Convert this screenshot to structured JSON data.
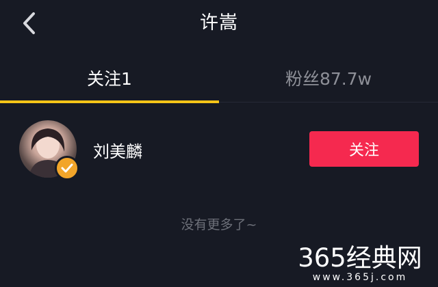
{
  "header": {
    "title": "许嵩",
    "back_icon": "chevron-left-icon"
  },
  "tabs": [
    {
      "label": "关注1",
      "active": true
    },
    {
      "label": "粉丝87.7w",
      "active": false
    }
  ],
  "colors": {
    "background": "#171a24",
    "tab_indicator": "#f5c518",
    "follow_button": "#f5294f",
    "verified_badge": "#f2a52a"
  },
  "following": [
    {
      "name": "刘美麟",
      "verified": true,
      "verified_icon": "check-badge-icon",
      "action_label": "关注"
    }
  ],
  "list_end_text": "没有更多了~",
  "watermark": {
    "main": "365经典网",
    "sub": "www.365j.com"
  }
}
